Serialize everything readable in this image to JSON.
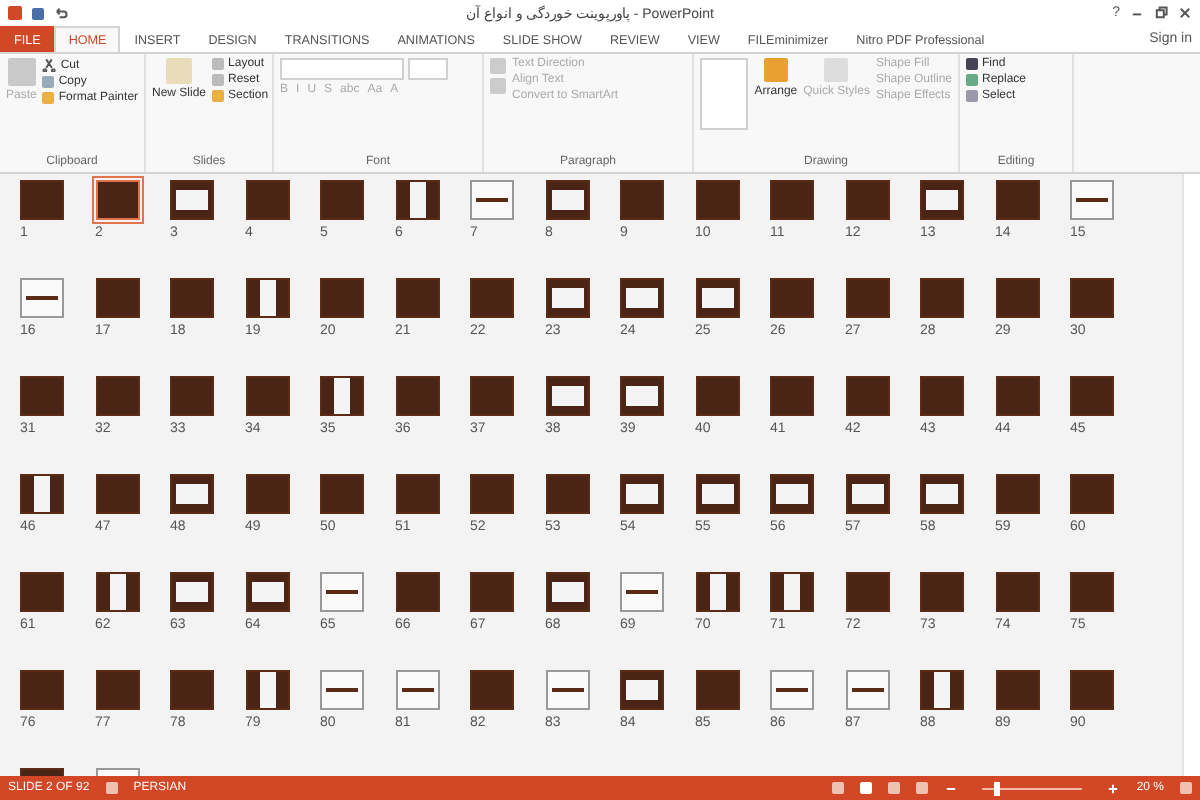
{
  "window": {
    "title": "پاورپوینت خوردگی و انواع آن - PowerPoint",
    "help": "?",
    "sign_in": "Sign in"
  },
  "tabs": [
    {
      "label": "FILE",
      "kind": "file",
      "selected": false
    },
    {
      "label": "HOME",
      "kind": "tab",
      "selected": true
    },
    {
      "label": "INSERT",
      "kind": "tab",
      "selected": false
    },
    {
      "label": "DESIGN",
      "kind": "tab",
      "selected": false
    },
    {
      "label": "TRANSITIONS",
      "kind": "tab",
      "selected": false
    },
    {
      "label": "ANIMATIONS",
      "kind": "tab",
      "selected": false
    },
    {
      "label": "SLIDE SHOW",
      "kind": "tab",
      "selected": false
    },
    {
      "label": "REVIEW",
      "kind": "tab",
      "selected": false
    },
    {
      "label": "VIEW",
      "kind": "tab",
      "selected": false
    },
    {
      "label": "FILEminimizer",
      "kind": "tab",
      "selected": false
    },
    {
      "label": "Nitro PDF Professional",
      "kind": "tab",
      "selected": false
    }
  ],
  "ribbon": {
    "clipboard": {
      "label": "Clipboard",
      "paste": "Paste",
      "cut": "Cut",
      "copy": "Copy",
      "format_painter": "Format Painter"
    },
    "slides": {
      "label": "Slides",
      "new_slide": "New Slide",
      "layout": "Layout",
      "reset": "Reset",
      "section": "Section"
    },
    "font": {
      "label": "Font",
      "buttons": [
        "B",
        "I",
        "U",
        "S",
        "abc",
        "Aa",
        "A"
      ]
    },
    "paragraph": {
      "label": "Paragraph",
      "text_direction": "Text Direction",
      "align_text": "Align Text",
      "convert": "Convert to SmartArt"
    },
    "drawing": {
      "label": "Drawing",
      "arrange": "Arrange",
      "quick_styles": "Quick Styles",
      "shape_fill": "Shape Fill",
      "shape_outline": "Shape Outline",
      "shape_effects": "Shape Effects"
    },
    "editing": {
      "label": "Editing",
      "find": "Find",
      "replace": "Replace",
      "select": "Select"
    }
  },
  "slides": [
    {
      "number": "1",
      "kind": "dark",
      "selected": false
    },
    {
      "number": "2",
      "kind": "dark",
      "selected": true
    },
    {
      "number": "3",
      "kind": "framed",
      "selected": false
    },
    {
      "number": "4",
      "kind": "dark",
      "selected": false
    },
    {
      "number": "5",
      "kind": "dark",
      "selected": false
    },
    {
      "number": "6",
      "kind": "portrait",
      "selected": false
    },
    {
      "number": "7",
      "kind": "white",
      "selected": false
    },
    {
      "number": "8",
      "kind": "framed",
      "selected": false
    },
    {
      "number": "9",
      "kind": "dark",
      "selected": false
    },
    {
      "number": "10",
      "kind": "dark",
      "selected": false
    },
    {
      "number": "11",
      "kind": "dark",
      "selected": false
    },
    {
      "number": "12",
      "kind": "dark",
      "selected": false
    },
    {
      "number": "13",
      "kind": "framed",
      "selected": false
    },
    {
      "number": "14",
      "kind": "dark",
      "selected": false
    },
    {
      "number": "15",
      "kind": "white",
      "selected": false
    },
    {
      "number": "16",
      "kind": "white",
      "selected": false
    },
    {
      "number": "17",
      "kind": "dark",
      "selected": false
    },
    {
      "number": "18",
      "kind": "dark",
      "selected": false
    },
    {
      "number": "19",
      "kind": "portrait",
      "selected": false
    },
    {
      "number": "20",
      "kind": "dark",
      "selected": false
    },
    {
      "number": "21",
      "kind": "dark",
      "selected": false
    },
    {
      "number": "22",
      "kind": "dark",
      "selected": false
    },
    {
      "number": "23",
      "kind": "framed",
      "selected": false
    },
    {
      "number": "24",
      "kind": "framed",
      "selected": false
    },
    {
      "number": "25",
      "kind": "framed",
      "selected": false
    },
    {
      "number": "26",
      "kind": "dark",
      "selected": false
    },
    {
      "number": "27",
      "kind": "dark",
      "selected": false
    },
    {
      "number": "28",
      "kind": "dark",
      "selected": false
    },
    {
      "number": "29",
      "kind": "dark",
      "selected": false
    },
    {
      "number": "30",
      "kind": "dark",
      "selected": false
    },
    {
      "number": "31",
      "kind": "dark",
      "selected": false
    },
    {
      "number": "32",
      "kind": "dark",
      "selected": false
    },
    {
      "number": "33",
      "kind": "dark",
      "selected": false
    },
    {
      "number": "34",
      "kind": "dark",
      "selected": false
    },
    {
      "number": "35",
      "kind": "portrait",
      "selected": false
    },
    {
      "number": "36",
      "kind": "dark",
      "selected": false
    },
    {
      "number": "37",
      "kind": "dark",
      "selected": false
    },
    {
      "number": "38",
      "kind": "framed",
      "selected": false
    },
    {
      "number": "39",
      "kind": "framed",
      "selected": false
    },
    {
      "number": "40",
      "kind": "dark",
      "selected": false
    },
    {
      "number": "41",
      "kind": "dark",
      "selected": false
    },
    {
      "number": "42",
      "kind": "dark",
      "selected": false
    },
    {
      "number": "43",
      "kind": "dark",
      "selected": false
    },
    {
      "number": "44",
      "kind": "dark",
      "selected": false
    },
    {
      "number": "45",
      "kind": "dark",
      "selected": false
    },
    {
      "number": "46",
      "kind": "portrait",
      "selected": false
    },
    {
      "number": "47",
      "kind": "dark",
      "selected": false
    },
    {
      "number": "48",
      "kind": "framed",
      "selected": false
    },
    {
      "number": "49",
      "kind": "dark",
      "selected": false
    },
    {
      "number": "50",
      "kind": "dark",
      "selected": false
    },
    {
      "number": "51",
      "kind": "dark",
      "selected": false
    },
    {
      "number": "52",
      "kind": "dark",
      "selected": false
    },
    {
      "number": "53",
      "kind": "dark",
      "selected": false
    },
    {
      "number": "54",
      "kind": "framed",
      "selected": false
    },
    {
      "number": "55",
      "kind": "framed",
      "selected": false
    },
    {
      "number": "56",
      "kind": "framed",
      "selected": false
    },
    {
      "number": "57",
      "kind": "framed",
      "selected": false
    },
    {
      "number": "58",
      "kind": "framed",
      "selected": false
    },
    {
      "number": "59",
      "kind": "dark",
      "selected": false
    },
    {
      "number": "60",
      "kind": "dark",
      "selected": false
    },
    {
      "number": "61",
      "kind": "dark",
      "selected": false
    },
    {
      "number": "62",
      "kind": "portrait",
      "selected": false
    },
    {
      "number": "63",
      "kind": "framed",
      "selected": false
    },
    {
      "number": "64",
      "kind": "framed",
      "selected": false
    },
    {
      "number": "65",
      "kind": "white",
      "selected": false
    },
    {
      "number": "66",
      "kind": "dark",
      "selected": false
    },
    {
      "number": "67",
      "kind": "dark",
      "selected": false
    },
    {
      "number": "68",
      "kind": "framed",
      "selected": false
    },
    {
      "number": "69",
      "kind": "white",
      "selected": false
    },
    {
      "number": "70",
      "kind": "portrait",
      "selected": false
    },
    {
      "number": "71",
      "kind": "portrait",
      "selected": false
    },
    {
      "number": "72",
      "kind": "dark",
      "selected": false
    },
    {
      "number": "73",
      "kind": "dark",
      "selected": false
    },
    {
      "number": "74",
      "kind": "dark",
      "selected": false
    },
    {
      "number": "75",
      "kind": "dark",
      "selected": false
    },
    {
      "number": "76",
      "kind": "dark",
      "selected": false
    },
    {
      "number": "77",
      "kind": "dark",
      "selected": false
    },
    {
      "number": "78",
      "kind": "dark",
      "selected": false
    },
    {
      "number": "79",
      "kind": "portrait",
      "selected": false
    },
    {
      "number": "80",
      "kind": "white",
      "selected": false
    },
    {
      "number": "81",
      "kind": "white",
      "selected": false
    },
    {
      "number": "82",
      "kind": "dark",
      "selected": false
    },
    {
      "number": "83",
      "kind": "white",
      "selected": false
    },
    {
      "number": "84",
      "kind": "framed",
      "selected": false
    },
    {
      "number": "85",
      "kind": "dark",
      "selected": false
    },
    {
      "number": "86",
      "kind": "white",
      "selected": false
    },
    {
      "number": "87",
      "kind": "white",
      "selected": false
    },
    {
      "number": "88",
      "kind": "portrait",
      "selected": false
    },
    {
      "number": "89",
      "kind": "dark",
      "selected": false
    },
    {
      "number": "90",
      "kind": "dark",
      "selected": false
    }
  ],
  "partial_slides": [
    {
      "kind": "dark"
    },
    {
      "kind": "white"
    }
  ],
  "status_bar": {
    "slide": "SLIDE 2 OF 92",
    "language": "PERSIAN",
    "zoom": "20 %",
    "zoom_slider": {
      "level": 0.15
    }
  }
}
